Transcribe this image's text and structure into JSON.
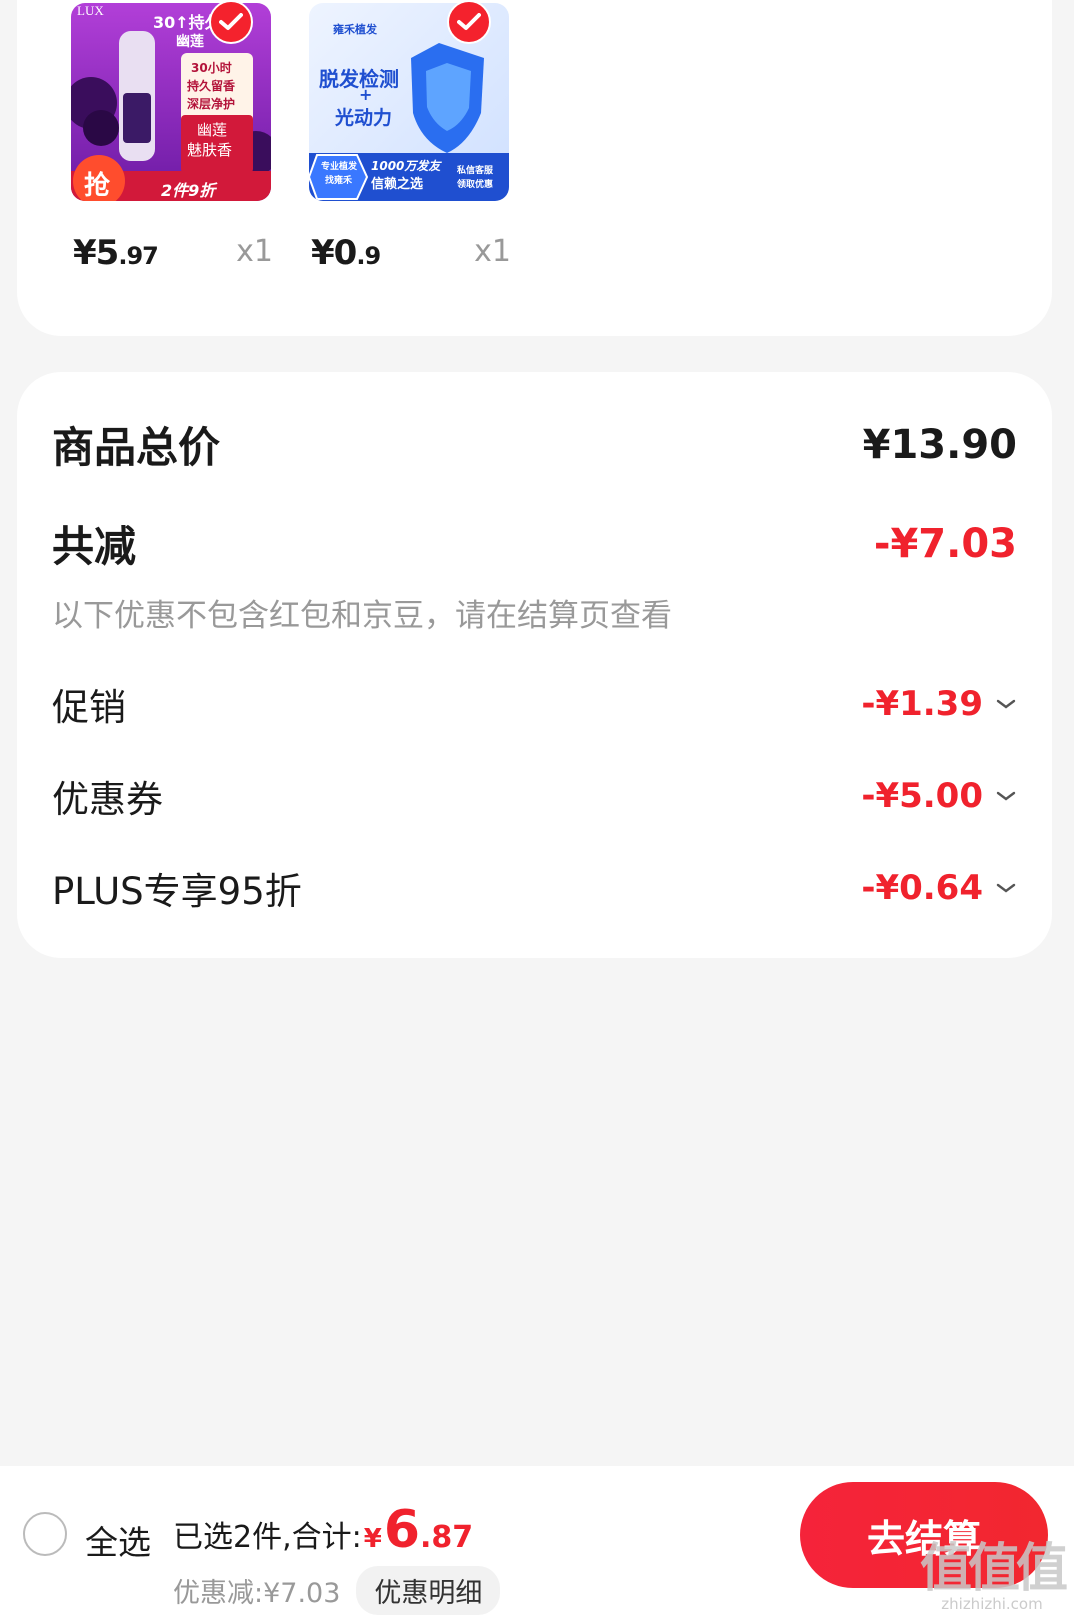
{
  "products": [
    {
      "price_int": "¥5",
      "price_dec": ".97",
      "qty": "x1",
      "image": {
        "brand": "LUX",
        "headline": "30↑持久留香",
        "sub": "幽莲",
        "badges": [
          "30小时",
          "持久留香",
          "深层净护"
        ],
        "feature": [
          "幽莲",
          "魅肤香"
        ],
        "promo_tag": "抢",
        "promo_text": "2件9折"
      }
    },
    {
      "price_int": "¥0",
      "price_dec": ".9",
      "qty": "x1",
      "image": {
        "brand": "雍禾植发",
        "headline_1": "脱发检测",
        "plus": "+",
        "headline_2": "光动力",
        "bottom_left": [
          "专业植发",
          "找雍禾"
        ],
        "bottom_mid": [
          "1000万发友",
          "信赖之选"
        ],
        "bottom_right": [
          "私信客服",
          "领取优惠"
        ]
      }
    }
  ],
  "summary": {
    "total_label": "商品总价",
    "total_value": "¥13.90",
    "reduce_label": "共减",
    "reduce_value": "-¥7.03",
    "note": "以下优惠不包含红包和京豆，请在结算页查看",
    "items": [
      {
        "label": "促销",
        "value": "-¥1.39"
      },
      {
        "label": "优惠券",
        "value": "-¥5.00"
      },
      {
        "label": "PLUS专享95折",
        "value": "-¥0.64"
      }
    ]
  },
  "bottom": {
    "select_all": "全选",
    "selected_prefix": "已选2件,合计:",
    "total_symbol": "¥",
    "total_int": "6",
    "total_dec": ".87",
    "discount_text": "优惠减:¥7.03",
    "detail_button": "优惠明细",
    "checkout_button": "去结算"
  },
  "watermark": {
    "logo": "值值值",
    "url": "zhizhizhi.com"
  },
  "colors": {
    "accent": "#f0222d",
    "muted": "#999999",
    "background": "#f5f5f5"
  }
}
